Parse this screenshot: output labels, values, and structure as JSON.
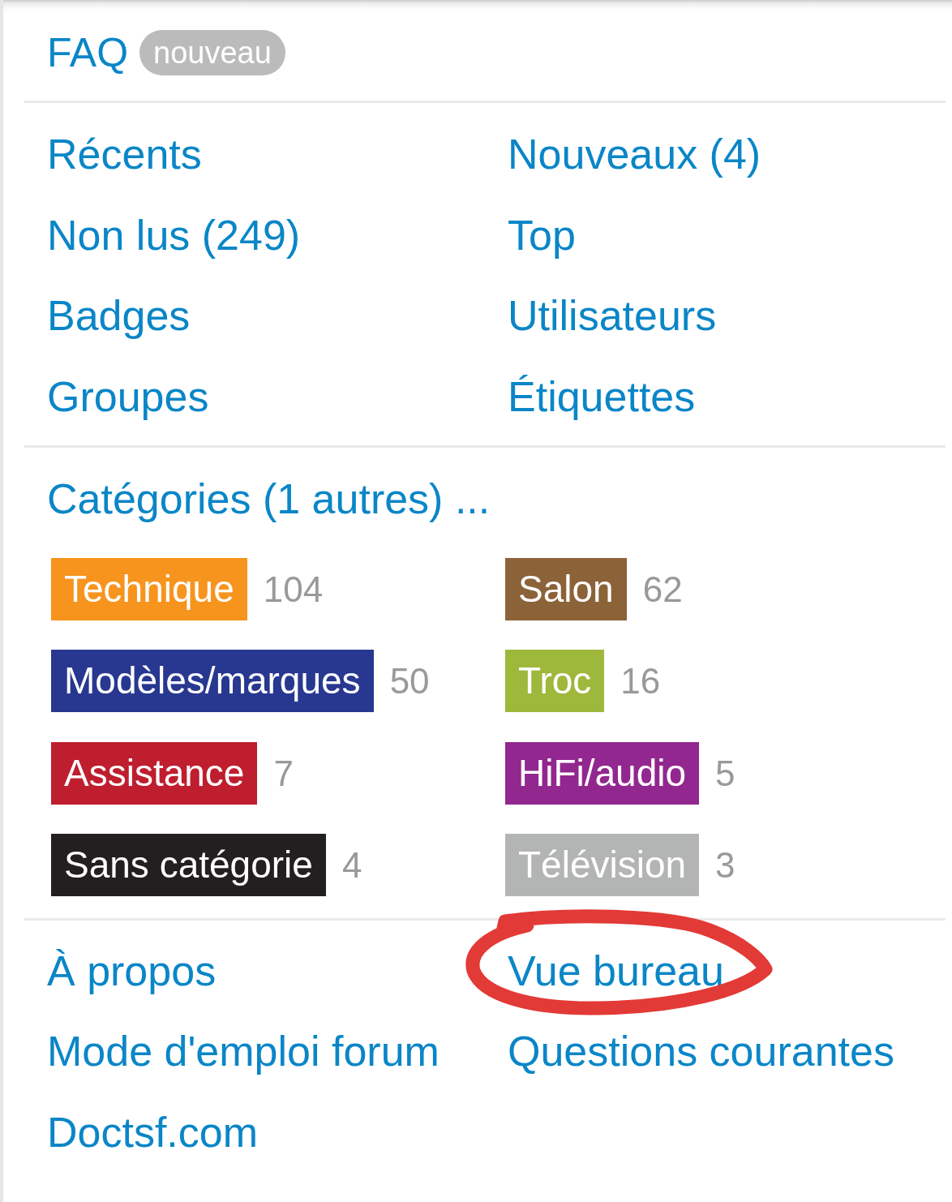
{
  "faq": {
    "label": "FAQ",
    "badge": "nouveau"
  },
  "links": [
    "Récents",
    "Nouveaux (4)",
    "Non lus (249)",
    "Top",
    "Badges",
    "Utilisateurs",
    "Groupes",
    "Étiquettes"
  ],
  "categories": {
    "heading": "Catégories (1 autres) ...",
    "items": [
      {
        "name": "Technique",
        "count": "104",
        "color": "#f7941d"
      },
      {
        "name": "Salon",
        "count": "62",
        "color": "#8c6238"
      },
      {
        "name": "Modèles/marques",
        "count": "50",
        "color": "#283890"
      },
      {
        "name": "Troc",
        "count": "16",
        "color": "#9eb83b"
      },
      {
        "name": "Assistance",
        "count": "7",
        "color": "#bf1e2e"
      },
      {
        "name": "HiFi/audio",
        "count": "5",
        "color": "#92278f"
      },
      {
        "name": "Sans catégorie",
        "count": "4",
        "color": "#231f20"
      },
      {
        "name": "Télévision",
        "count": "3",
        "color": "#b3b5b4"
      }
    ]
  },
  "footer_links": [
    {
      "label": "À propos",
      "circled": false
    },
    {
      "label": "Vue bureau",
      "circled": true
    },
    {
      "label": "Mode d'emploi forum",
      "circled": false
    },
    {
      "label": "Questions courantes",
      "circled": false
    },
    {
      "label": "Doctsf.com",
      "circled": false
    }
  ]
}
